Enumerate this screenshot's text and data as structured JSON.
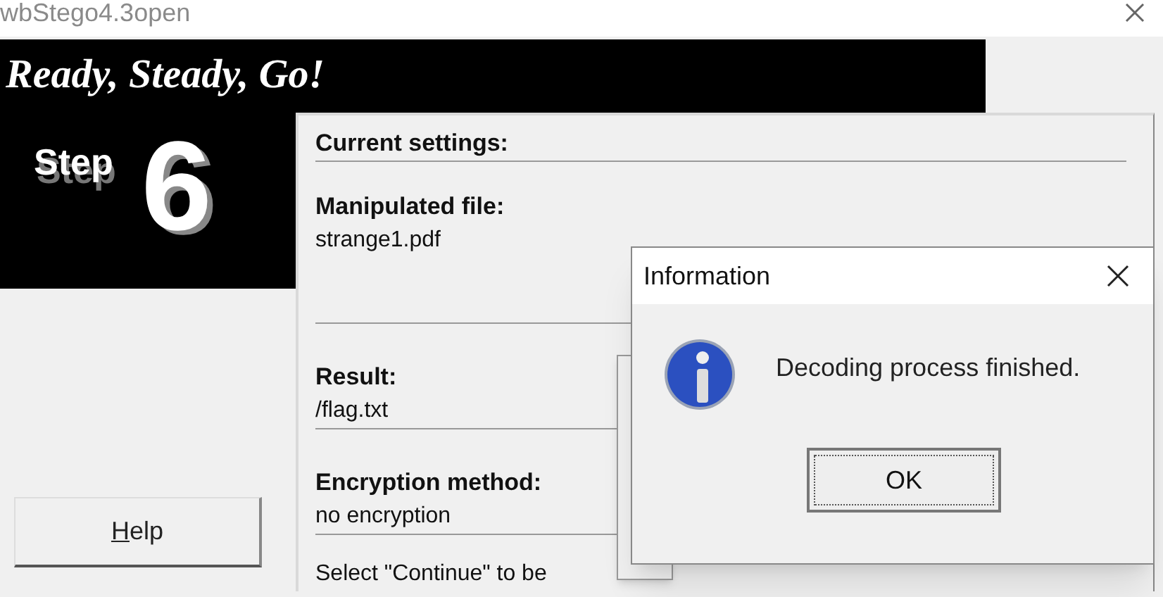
{
  "window": {
    "title": "wbStego4.3open"
  },
  "banner": {
    "title": "Ready, Steady, Go!",
    "step_label": "Step",
    "step_number": "6"
  },
  "settings": {
    "heading": "Current settings:",
    "fields": [
      {
        "label": "Manipulated file:",
        "value": "strange1.pdf"
      },
      {
        "label": "Result:",
        "value": "/flag.txt"
      },
      {
        "label": "Encryption method:",
        "value": "no encryption"
      }
    ],
    "instruction": "Select \"Continue\" to be"
  },
  "buttons": [
    {
      "label": "Help"
    }
  ],
  "dialog": {
    "title": "Information",
    "message": "Decoding process finished.",
    "button": "OK"
  }
}
